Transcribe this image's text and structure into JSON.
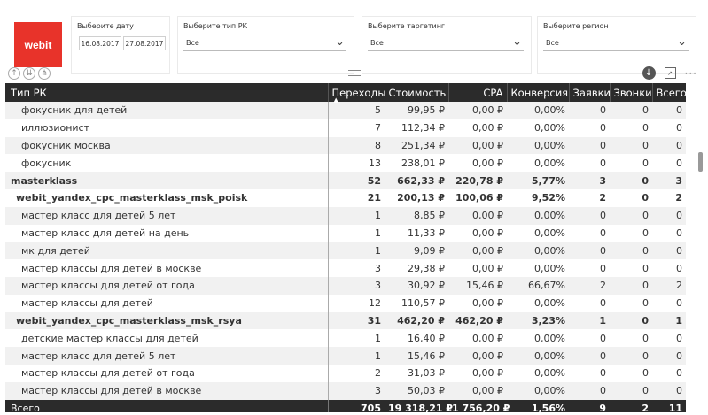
{
  "logo": {
    "text": "webit",
    "color": "#e8332a"
  },
  "filters": {
    "date": {
      "title": "Выберите дату",
      "from": "16.08.2017",
      "to": "27.08.2017"
    },
    "campaign_type": {
      "title": "Выберите тип РК",
      "value": "Все"
    },
    "targeting": {
      "title": "Выберите таргетинг",
      "value": "Все"
    },
    "region": {
      "title": "Выберите регион",
      "value": "Все"
    }
  },
  "icons": {
    "left": [
      "arrow-up-icon",
      "double-arrow-down-icon",
      "expand-hierarchy-icon"
    ],
    "right": [
      "download-icon",
      "focus-mode-icon",
      "more-options-icon"
    ]
  },
  "table": {
    "columns": [
      "Тип РК",
      "Переходы",
      "Стоимость",
      "CPA",
      "Конверсия",
      "Заявки",
      "Звонки",
      "Всего"
    ],
    "sorted_column": "Переходы",
    "rows": [
      {
        "level": 2,
        "bold": false,
        "cells": [
          "фокусник для детей",
          "5",
          "99,95 ₽",
          "0,00 ₽",
          "0,00%",
          "0",
          "0",
          "0"
        ]
      },
      {
        "level": 2,
        "bold": false,
        "cells": [
          "иллюзионист",
          "7",
          "112,34 ₽",
          "0,00 ₽",
          "0,00%",
          "0",
          "0",
          "0"
        ]
      },
      {
        "level": 2,
        "bold": false,
        "cells": [
          "фокусник москва",
          "8",
          "251,34 ₽",
          "0,00 ₽",
          "0,00%",
          "0",
          "0",
          "0"
        ]
      },
      {
        "level": 2,
        "bold": false,
        "cells": [
          "фокусник",
          "13",
          "238,01 ₽",
          "0,00 ₽",
          "0,00%",
          "0",
          "0",
          "0"
        ]
      },
      {
        "level": 0,
        "bold": true,
        "cells": [
          "masterklass",
          "52",
          "662,33 ₽",
          "220,78 ₽",
          "5,77%",
          "3",
          "0",
          "3"
        ]
      },
      {
        "level": 1,
        "bold": true,
        "cells": [
          "webit_yandex_cpc_masterklass_msk_poisk",
          "21",
          "200,13 ₽",
          "100,06 ₽",
          "9,52%",
          "2",
          "0",
          "2"
        ]
      },
      {
        "level": 2,
        "bold": false,
        "cells": [
          "мастер класс для детей 5 лет",
          "1",
          "8,85 ₽",
          "0,00 ₽",
          "0,00%",
          "0",
          "0",
          "0"
        ]
      },
      {
        "level": 2,
        "bold": false,
        "cells": [
          "мастер класс для детей на день",
          "1",
          "11,33 ₽",
          "0,00 ₽",
          "0,00%",
          "0",
          "0",
          "0"
        ]
      },
      {
        "level": 2,
        "bold": false,
        "cells": [
          "мк для детей",
          "1",
          "9,09 ₽",
          "0,00 ₽",
          "0,00%",
          "0",
          "0",
          "0"
        ]
      },
      {
        "level": 2,
        "bold": false,
        "cells": [
          "мастер классы для детей в москве",
          "3",
          "29,38 ₽",
          "0,00 ₽",
          "0,00%",
          "0",
          "0",
          "0"
        ]
      },
      {
        "level": 2,
        "bold": false,
        "cells": [
          "мастер классы для детей от года",
          "3",
          "30,92 ₽",
          "15,46 ₽",
          "66,67%",
          "2",
          "0",
          "2"
        ]
      },
      {
        "level": 2,
        "bold": false,
        "cells": [
          "мастер классы для детей",
          "12",
          "110,57 ₽",
          "0,00 ₽",
          "0,00%",
          "0",
          "0",
          "0"
        ]
      },
      {
        "level": 1,
        "bold": true,
        "cells": [
          "webit_yandex_cpc_masterklass_msk_rsya",
          "31",
          "462,20 ₽",
          "462,20 ₽",
          "3,23%",
          "1",
          "0",
          "1"
        ]
      },
      {
        "level": 2,
        "bold": false,
        "cells": [
          "детские мастер классы для детей",
          "1",
          "16,40 ₽",
          "0,00 ₽",
          "0,00%",
          "0",
          "0",
          "0"
        ]
      },
      {
        "level": 2,
        "bold": false,
        "cells": [
          "мастер класс для детей 5 лет",
          "1",
          "15,46 ₽",
          "0,00 ₽",
          "0,00%",
          "0",
          "0",
          "0"
        ]
      },
      {
        "level": 2,
        "bold": false,
        "cells": [
          "мастер классы для детей от года",
          "2",
          "31,03 ₽",
          "0,00 ₽",
          "0,00%",
          "0",
          "0",
          "0"
        ]
      },
      {
        "level": 2,
        "bold": false,
        "cells": [
          "мастер классы для детей в москве",
          "3",
          "50,03 ₽",
          "0,00 ₽",
          "0,00%",
          "0",
          "0",
          "0"
        ]
      }
    ],
    "totals": [
      "Всего",
      "705",
      "19 318,21 ₽",
      "1 756,20 ₽",
      "1,56%",
      "9",
      "2",
      "11"
    ]
  }
}
